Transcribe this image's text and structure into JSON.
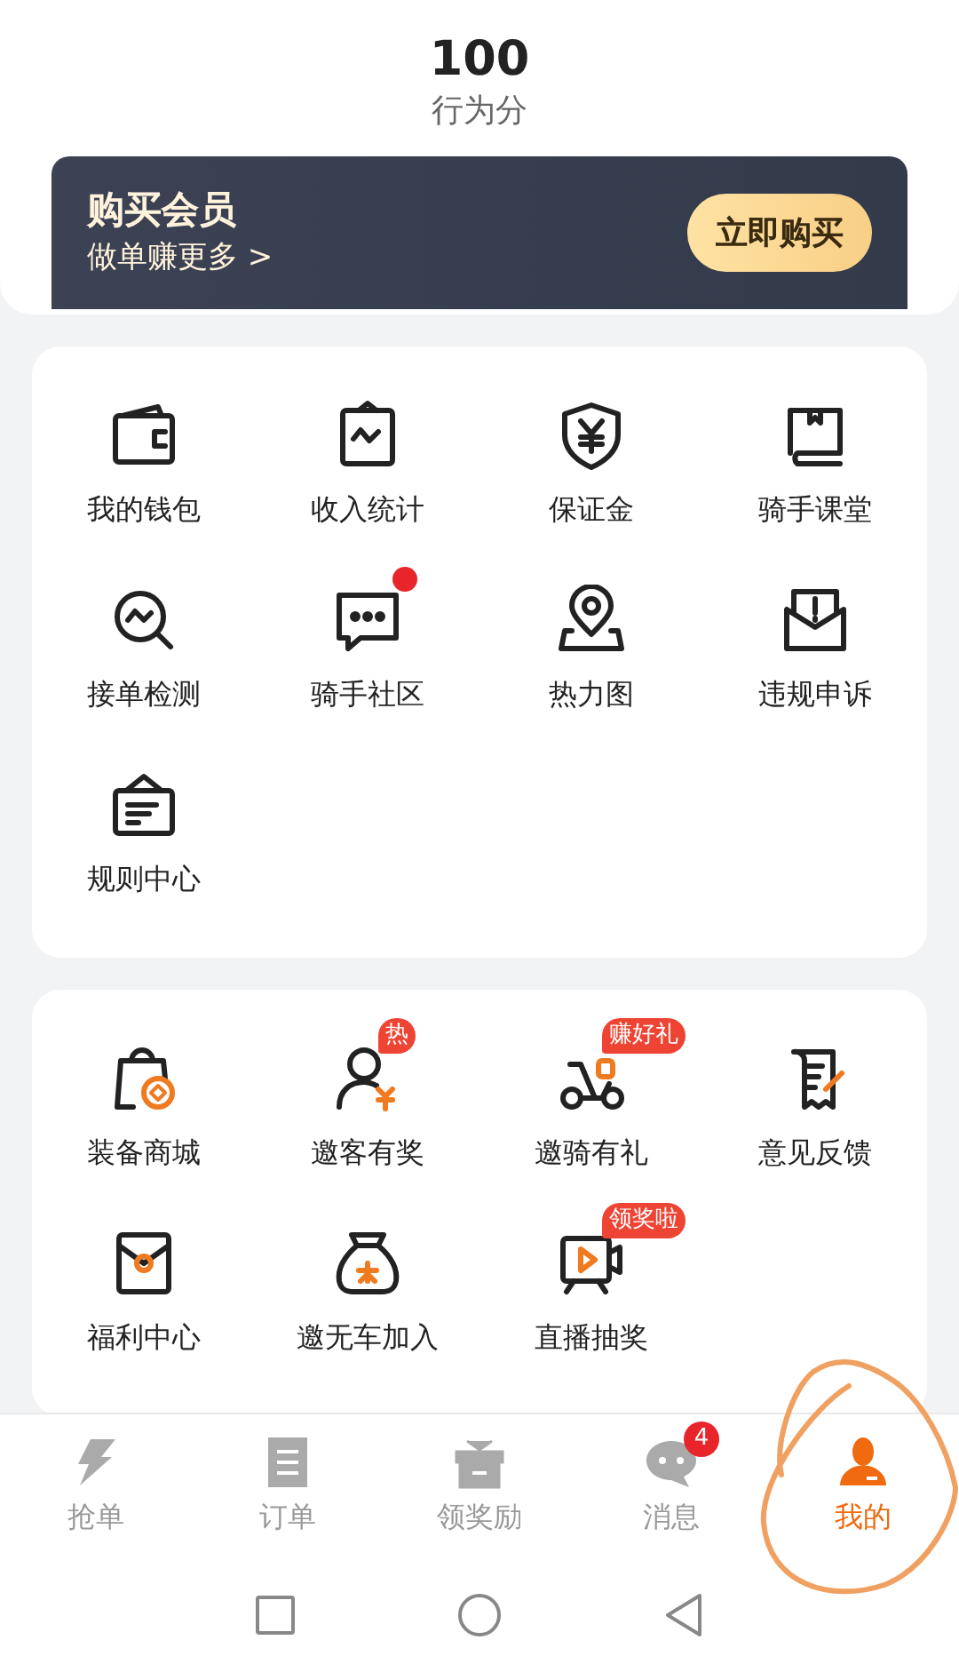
{
  "score": {
    "value": "100",
    "label": "行为分"
  },
  "banner": {
    "title": "购买会员",
    "subtitle": "做单赚更多 >",
    "button": "立即购买"
  },
  "sections": [
    {
      "items": [
        {
          "label": "我的钱包"
        },
        {
          "label": "收入统计"
        },
        {
          "label": "保证金"
        },
        {
          "label": "骑手课堂"
        },
        {
          "label": "接单检测"
        },
        {
          "label": "骑手社区",
          "badge": {
            "kind": "dot"
          }
        },
        {
          "label": "热力图"
        },
        {
          "label": "违规申诉"
        },
        {
          "label": "规则中心"
        }
      ]
    },
    {
      "items": [
        {
          "label": "装备商城"
        },
        {
          "label": "邀客有奖",
          "badge": {
            "kind": "text",
            "text": "热"
          }
        },
        {
          "label": "邀骑有礼",
          "badge": {
            "kind": "text",
            "text": "赚好礼"
          }
        },
        {
          "label": "意见反馈"
        },
        {
          "label": "福利中心"
        },
        {
          "label": "邀无车加入"
        },
        {
          "label": "直播抽奖",
          "badge": {
            "kind": "text",
            "text": "领奖啦"
          }
        }
      ]
    }
  ],
  "tabs": [
    {
      "label": "抢单",
      "selected": false
    },
    {
      "label": "订单",
      "selected": false
    },
    {
      "label": "领奖励",
      "selected": false
    },
    {
      "label": "消息",
      "selected": false,
      "badge": "4"
    },
    {
      "label": "我的",
      "selected": true
    }
  ]
}
